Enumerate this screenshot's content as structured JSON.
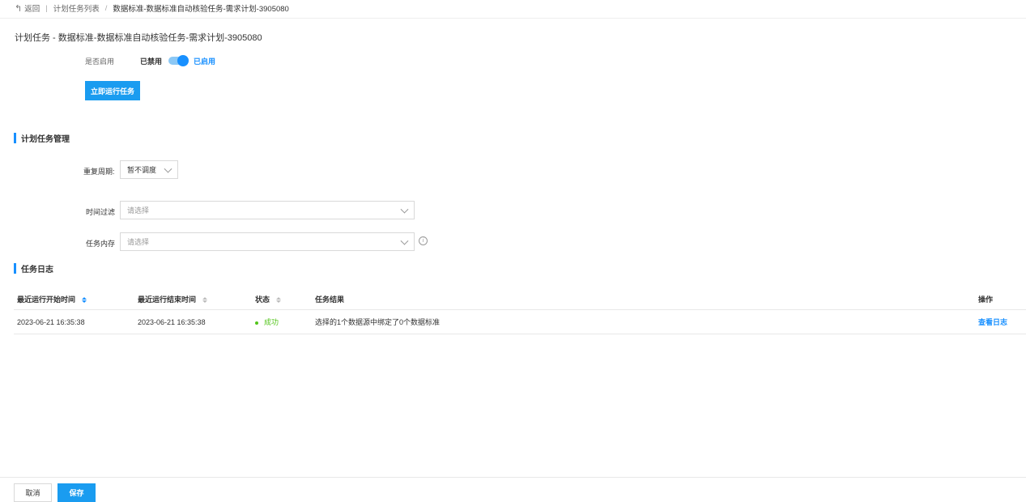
{
  "breadcrumb": {
    "back_label": "返回",
    "separator": "|",
    "list_label": "计划任务列表",
    "slash": "/",
    "current_label": "数据标准-数据标准自动核验任务-需求计划-3905080"
  },
  "page": {
    "title": "计划任务 - 数据标准-数据标准自动核验任务-需求计划-3905080"
  },
  "enable": {
    "label": "是否启用",
    "off_label": "已禁用",
    "on_label": "已启用",
    "enabled": true
  },
  "actions": {
    "run_now_label": "立即运行任务"
  },
  "schedule_section": {
    "title": "计划任务管理",
    "repeat_label": "重复周期:",
    "repeat_value": "暂不调度",
    "time_filter_label": "时间过滤",
    "time_filter_placeholder": "请选择",
    "memory_label": "任务内存",
    "memory_placeholder": "请选择",
    "info_icon": "info-icon"
  },
  "log_section": {
    "title": "任务日志",
    "columns": {
      "start_time": "最近运行开始时间",
      "end_time": "最近运行结束时间",
      "status": "状态",
      "result": "任务结果",
      "operation": "操作"
    },
    "rows": [
      {
        "start_time": "2023-06-21 16:35:38",
        "end_time": "2023-06-21 16:35:38",
        "status": "成功",
        "result": "选择的1个数据源中绑定了0个数据标准",
        "action": "查看日志"
      }
    ]
  },
  "footer": {
    "cancel_label": "取消",
    "save_label": "保存"
  },
  "colors": {
    "primary": "#1890ff",
    "button": "#1a9cf0",
    "success": "#52c41a"
  }
}
